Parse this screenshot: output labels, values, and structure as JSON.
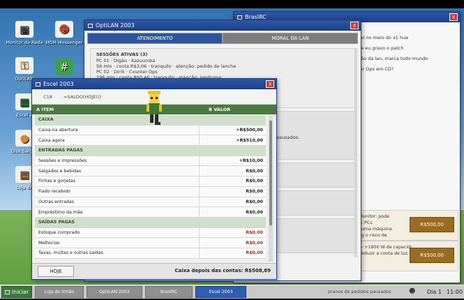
{
  "desktop": {
    "icons": [
      {
        "label": "Monitor de Rede",
        "glyph": "▣",
        "color": "#3a3a3a"
      },
      {
        "label": "MSM Messenger",
        "glyph": "☻",
        "color": "#c24a34"
      },
      {
        "label": "OptiLAN",
        "glyph": "⚿",
        "color": "#b08a2e"
      },
      {
        "label": "Escel 2",
        "glyph": "▦",
        "color": "#2e6b3a"
      },
      {
        "label": "Disk Salgad",
        "glyph": "●",
        "color": "#d08a2a"
      },
      {
        "label": "Loja do",
        "glyph": "▤",
        "color": "#9a6a2a"
      }
    ],
    "messenger_badge": "#"
  },
  "irc": {
    "title": "BrasIRC",
    "close": "X",
    "chat": [
      "cai no meio do x1 hue",
      "ue eu gravo o patch",
      "gão da lan, marca todo mundo",
      "ter Ops em CD?"
    ],
    "card1_text": "lonitor: pode\n; PCs\numa máquina.\ng o risco de",
    "card1_price": "R$500,00",
    "card2_text": "- +1800 W de capacidade. Segura o salão principal\neduzir a conta de luz.",
    "card2_price": "R$500,00"
  },
  "optilan": {
    "title": "OptiLAN 2003",
    "close": "X",
    "tabs": {
      "atendimento": "ATENDIMENTO",
      "moral": "MORAL DA LAN"
    },
    "sessions_header": "SESSÕES ATIVAS (3)",
    "sessions": [
      {
        "pc": "PC 01 · Digão · Kazuumba",
        "detail": "56 min · conta R$3,06 · tranquilo · atenção: pedido de lanche"
      },
      {
        "pc": "PC 02 · Dirrk · Counter Ops",
        "detail": "196 min · conta R$0,46 · tranquilo · atenção: nenhuma"
      }
    ],
    "status": "pausados."
  },
  "escel": {
    "title": "Escel 2003",
    "close": "X",
    "cell_ref": "C18",
    "formula": "=SALDO(HOJE())",
    "col_a": "A ITEM",
    "col_b": "B VALOR",
    "rows": [
      {
        "type": "section",
        "label": "CAIXA"
      },
      {
        "type": "item",
        "label": "Caixa na abertura",
        "value": "+R$500,00",
        "tone": "pos"
      },
      {
        "type": "item",
        "label": "Caixa agora",
        "value": "+R$510,00",
        "tone": "pos"
      },
      {
        "type": "section",
        "label": "ENTRADAS PAGAS"
      },
      {
        "type": "item",
        "label": "Sessões e impressões",
        "value": "+R$10,00",
        "tone": "pos"
      },
      {
        "type": "item",
        "label": "Salgados e bebidas",
        "value": "R$0,00",
        "tone": "pos"
      },
      {
        "type": "item",
        "label": "Fichas e gorjetas",
        "value": "R$0,00",
        "tone": "pos"
      },
      {
        "type": "item",
        "label": "Fiado recebido",
        "value": "R$0,00",
        "tone": "pos"
      },
      {
        "type": "item",
        "label": "Outras entradas",
        "value": "R$0,00",
        "tone": "pos"
      },
      {
        "type": "item",
        "label": "Empréstimo da mãe",
        "value": "R$0,00",
        "tone": "pos"
      },
      {
        "type": "section",
        "label": "SAÍDAS PAGAS"
      },
      {
        "type": "item",
        "label": "Estoque comprado",
        "value": "R$0,00",
        "tone": "neg"
      },
      {
        "type": "item",
        "label": "Melhorias",
        "value": "R$0,00",
        "tone": "neg"
      },
      {
        "type": "item",
        "label": "Taxas, multas e outras saídas",
        "value": "R$0,00",
        "tone": "neg"
      }
    ],
    "hoje_button": "HOJE",
    "footer_total": "Caixa depois das contas: R$508,89"
  },
  "taskbar": {
    "start": "Iniciar",
    "tasks": [
      {
        "label": "Loja do Irmão",
        "active": false,
        "width": 70
      },
      {
        "label": "OptiLAN 2003",
        "active": false,
        "width": 80
      },
      {
        "label": "BrasIRC",
        "active": false,
        "width": 68
      },
      {
        "label": "Escel 2003",
        "active": true,
        "width": 73
      }
    ],
    "status": "pranos de pedidos pausados",
    "day": "Dia 1",
    "time": "11:00"
  },
  "colors": {
    "accent_blue": "#2d559e",
    "sheet_green": "#4a7a3e",
    "negative": "#b12b1f",
    "price_brown": "#9c6b22"
  }
}
